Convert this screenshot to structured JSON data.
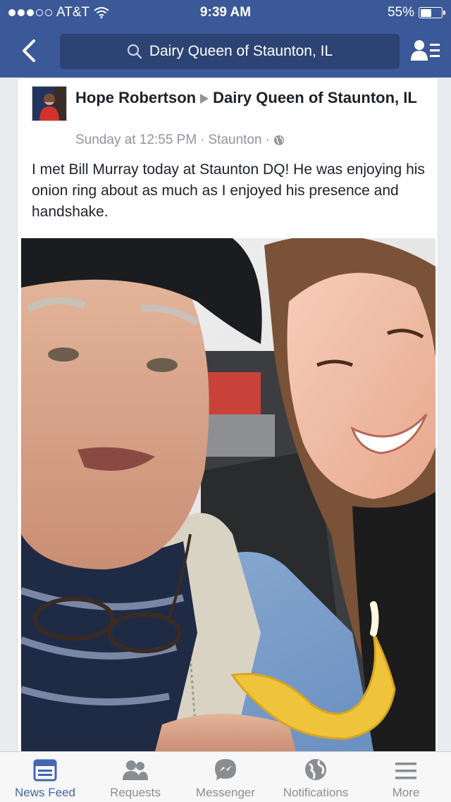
{
  "status_bar": {
    "carrier": "AT&T",
    "time": "9:39 AM",
    "battery": "55%",
    "battery_level": 0.55,
    "signal_bars": 3
  },
  "nav": {
    "search_text": "Dairy Queen of Staunton, IL"
  },
  "post": {
    "author": "Hope Robertson",
    "target": "Dairy Queen of Staunton, IL",
    "timestamp": "Sunday at 12:55 PM",
    "location": "Staunton",
    "privacy_icon": "globe-icon",
    "text": "I met Bill Murray today at Staunton DQ! He was enjoying his onion ring about as much as I enjoyed his presence and handshake."
  },
  "tabs": [
    {
      "label": "News Feed",
      "icon": "news-feed-icon",
      "active": true
    },
    {
      "label": "Requests",
      "icon": "requests-icon",
      "active": false
    },
    {
      "label": "Messenger",
      "icon": "messenger-icon",
      "active": false
    },
    {
      "label": "Notifications",
      "icon": "globe-icon",
      "active": false
    },
    {
      "label": "More",
      "icon": "menu-icon",
      "active": false
    }
  ],
  "colors": {
    "brand": "#3b5998",
    "search_bg": "#2d4373",
    "active_tab": "#4267b2"
  }
}
